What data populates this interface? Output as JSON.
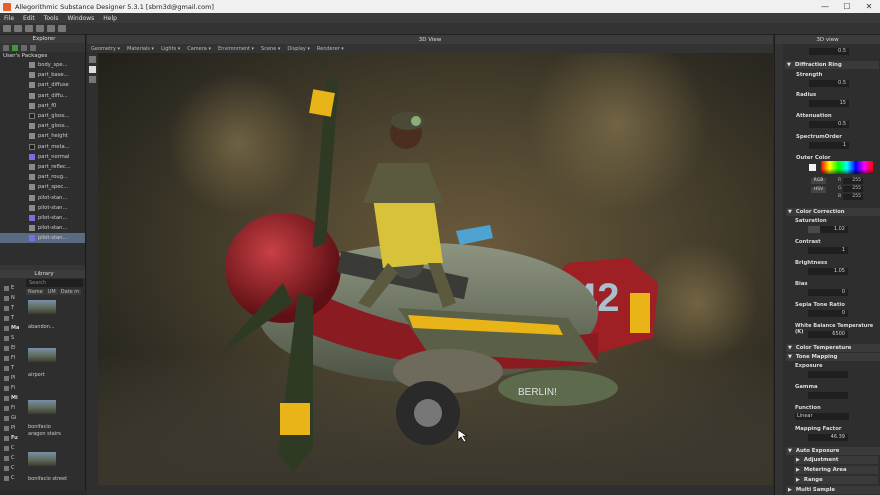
{
  "window": {
    "title": "Allegorithmic Substance Designer 5.3.1 [sbrn3d@gmail.com]",
    "controls": [
      "—",
      "☐",
      "✕"
    ]
  },
  "menu": [
    "File",
    "Edit",
    "Tools",
    "Windows",
    "Help"
  ],
  "explorer": {
    "title": "Explorer",
    "packages_label": "User's Packages",
    "items": [
      {
        "label": "body_spe...",
        "icon": "gray"
      },
      {
        "label": "part_base...",
        "icon": "gray"
      },
      {
        "label": "part_diffuse",
        "icon": "gray"
      },
      {
        "label": "part_diffu...",
        "icon": "gray"
      },
      {
        "label": "part_f0",
        "icon": "gray"
      },
      {
        "label": "part_gloss...",
        "icon": "dark"
      },
      {
        "label": "part_gloss...",
        "icon": "gray"
      },
      {
        "label": "part_height",
        "icon": "gray"
      },
      {
        "label": "part_meta...",
        "icon": "dark"
      },
      {
        "label": "part_normal",
        "icon": "purple"
      },
      {
        "label": "part_reflec...",
        "icon": "gray"
      },
      {
        "label": "part_roug...",
        "icon": "gray"
      },
      {
        "label": "part_spec...",
        "icon": "gray"
      },
      {
        "label": "pilot-stan...",
        "icon": "gray"
      },
      {
        "label": "pilot-stan...",
        "icon": "gray"
      },
      {
        "label": "pilot-stan...",
        "icon": "purple"
      },
      {
        "label": "pilot-stan...",
        "icon": "gray"
      },
      {
        "label": "pilot-stan...",
        "icon": "purple",
        "selected": true
      }
    ]
  },
  "library": {
    "title": "Library",
    "search_placeholder": "Search",
    "columns": [
      "Name",
      "UM",
      "Date m"
    ],
    "categories": [
      {
        "label": "E",
        "header": false
      },
      {
        "label": "N",
        "header": false
      },
      {
        "label": "T",
        "header": false
      },
      {
        "label": "T",
        "header": false
      },
      {
        "label": "Ma",
        "header": true
      },
      {
        "label": "S",
        "header": false
      },
      {
        "label": "El",
        "header": false
      },
      {
        "label": "Fl",
        "header": false
      },
      {
        "label": "T",
        "header": false
      },
      {
        "label": "Pl",
        "header": false
      },
      {
        "label": "Fi",
        "header": false
      },
      {
        "label": "Mi",
        "header": true
      },
      {
        "label": "Fi",
        "header": false
      },
      {
        "label": "Gi",
        "header": false
      },
      {
        "label": "Pl",
        "header": false
      },
      {
        "label": "Fu",
        "header": true
      },
      {
        "label": "C",
        "header": false
      },
      {
        "label": "C",
        "header": false
      },
      {
        "label": "C",
        "header": false
      },
      {
        "label": "C",
        "header": false
      }
    ],
    "thumbnails": [
      "abandon...",
      "airport",
      "bonifacio aragon stairs",
      "bonifacio street"
    ]
  },
  "viewport": {
    "title": "3D View",
    "menu": [
      "Geometry ▾",
      "Materials ▾",
      "Lights ▾",
      "Camera ▾",
      "Environment ▾",
      "Scene ▾",
      "Display ▾",
      "Renderer ▾"
    ]
  },
  "props": {
    "title": "3D view",
    "top_value": "0.5",
    "diffraction": {
      "title": "Diffraction Ring",
      "strength_label": "Strength",
      "strength_value": "0.5",
      "radius_label": "Radius",
      "radius_value": "15",
      "attenuation_label": "Attenuation",
      "attenuation_value": "0.5",
      "spectrum_label": "SpectrumOrder",
      "spectrum_value": "1",
      "outer_color_label": "Outer Color",
      "rgb_tag": "RGB",
      "hsv_tag": "HSV",
      "channels": [
        {
          "ch": "R",
          "val": "255"
        },
        {
          "ch": "G",
          "val": "255"
        },
        {
          "ch": "B",
          "val": "255"
        }
      ]
    },
    "color_correction": {
      "title": "Color Correction",
      "saturation_label": "Saturation",
      "saturation_value": "1.02",
      "contrast_label": "Contrast",
      "contrast_value": "1",
      "brightness_label": "Brightness",
      "brightness_value": "1.05",
      "bias_label": "Bias",
      "bias_value": "0",
      "sepia_label": "Sepia Tone Ratio",
      "sepia_value": "0",
      "wb_label": "White Balance Temperature (K)",
      "wb_value": "6500"
    },
    "color_temperature": {
      "title": "Color Temperature"
    },
    "tone_mapping": {
      "title": "Tone Mapping",
      "exposure_label": "Exposure",
      "exposure_value": "",
      "gamma_label": "Gamma",
      "gamma_value": "",
      "function_label": "Function",
      "function_value": "Linear",
      "mapping_label": "Mapping Factor",
      "mapping_value": "46.39"
    },
    "auto_exposure": {
      "title": "Auto Exposure"
    },
    "adjustment": {
      "title": "Adjustment"
    },
    "metering": {
      "title": "Metering Area"
    },
    "range": {
      "title": "Range"
    },
    "multisample": {
      "title": "Multi Sample"
    }
  },
  "scene": {
    "tail_number": "42",
    "bomb_text": "BERLIN!"
  },
  "colors": {
    "accent": "#e85d2a",
    "selection": "#5a6a80",
    "plane_red": "#9e1f24",
    "stripe_yellow": "#e8b417"
  }
}
